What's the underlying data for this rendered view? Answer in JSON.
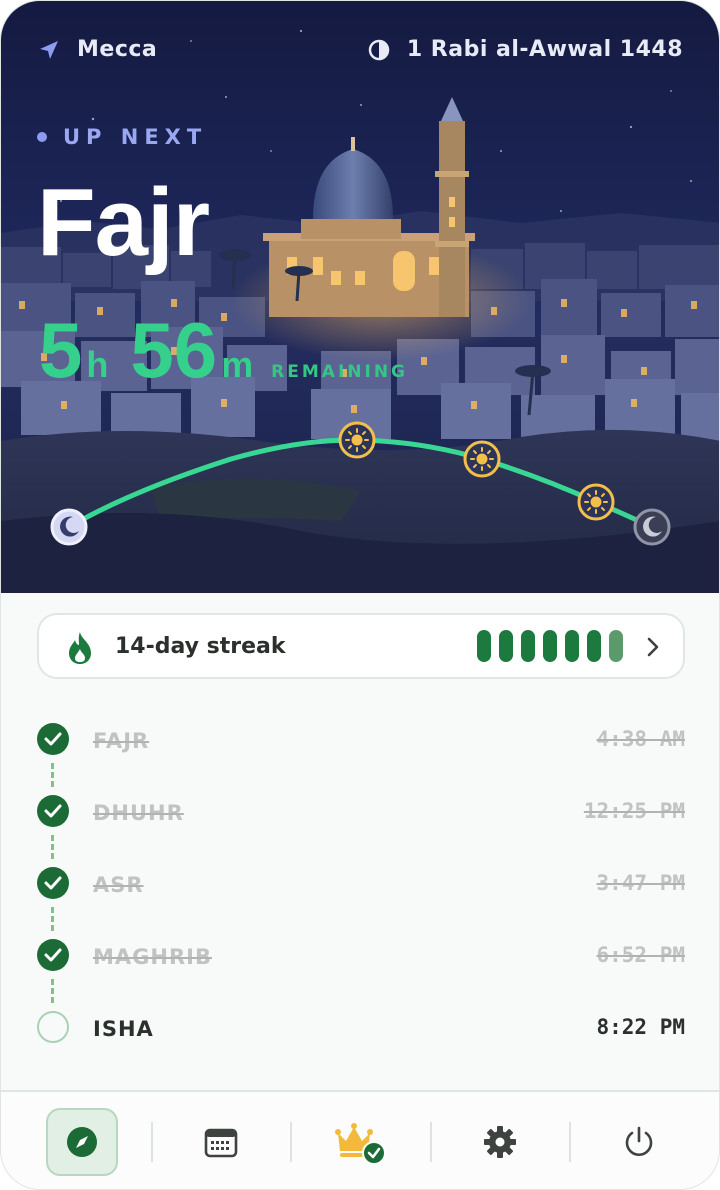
{
  "header": {
    "location": "Mecca",
    "hijri_date": "1 Rabi al-Awwal 1448",
    "location_icon": "location-arrow-icon",
    "date_icon": "moon-phase-icon"
  },
  "next_prayer": {
    "label": "UP NEXT",
    "name": "Fajr",
    "countdown": {
      "hours": "5",
      "hours_unit": "h",
      "minutes": "56",
      "minutes_unit": "m",
      "suffix": "REMAINING"
    }
  },
  "streak": {
    "label": "14-day streak",
    "icon": "flame-icon",
    "bars_total": 7,
    "bars_full": 6
  },
  "prayers": [
    {
      "name": "FAJR",
      "time": "4:38 AM",
      "done": true
    },
    {
      "name": "DHUHR",
      "time": "12:25 PM",
      "done": true
    },
    {
      "name": "ASR",
      "time": "3:47 PM",
      "done": true
    },
    {
      "name": "MAGHRIB",
      "time": "6:52 PM",
      "done": true
    },
    {
      "name": "ISHA",
      "time": "8:22 PM",
      "done": false
    }
  ],
  "nav": [
    {
      "id": "compass",
      "icon": "compass-icon",
      "active": true
    },
    {
      "id": "calendar",
      "icon": "calendar-icon",
      "active": false
    },
    {
      "id": "premium",
      "icon": "crown-icon",
      "active": false
    },
    {
      "id": "settings",
      "icon": "gear-icon",
      "active": false
    },
    {
      "id": "power",
      "icon": "power-icon",
      "active": false
    }
  ],
  "colors": {
    "accent_green": "#35d08c",
    "done_green": "#1c6b36",
    "sun_gold": "#f2c04a",
    "night_sky": "#1a2150"
  }
}
